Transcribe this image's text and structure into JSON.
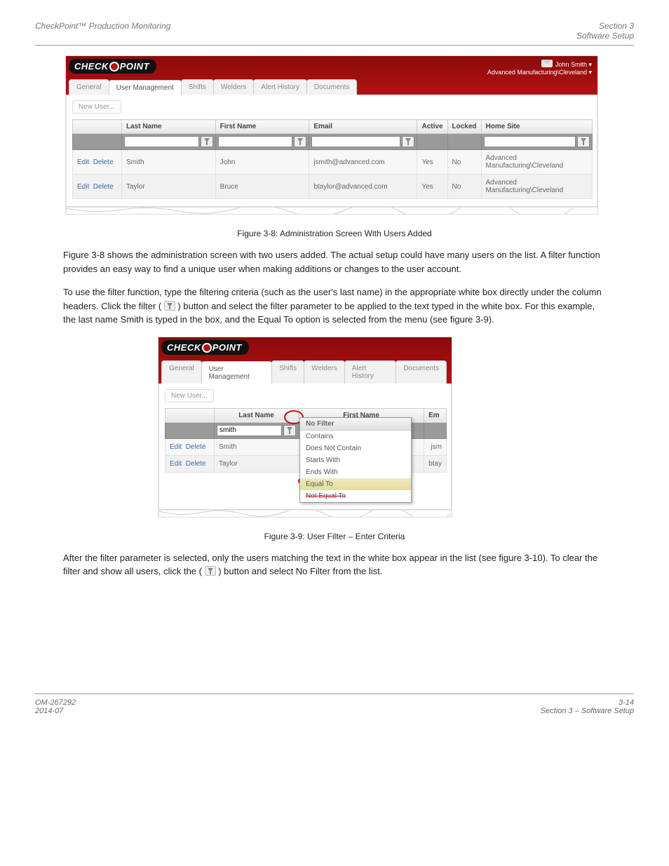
{
  "pageHeader": {
    "left": "CheckPoint™ Production Monitoring",
    "rightLine1": "Section 3",
    "rightLine2": "Software Setup"
  },
  "pageFooter": {
    "leftLine1": "OM-267292",
    "leftLine2": "2014-07",
    "rightLine1": "3-14",
    "rightLine2": "Section 3 – Software Setup"
  },
  "logo": {
    "chk": "CHECK",
    "pnt": "POINT"
  },
  "account": {
    "user": "John Smith",
    "site": "Advanced Manufacturing\\Cleveland"
  },
  "tabs": [
    "General",
    "User Management",
    "Shifts",
    "Welders",
    "Alert History",
    "Documents"
  ],
  "newUser": "New User...",
  "cols": {
    "last": "Last Name",
    "first": "First Name",
    "email": "Email",
    "active": "Active",
    "locked": "Locked",
    "home": "Home Site",
    "em": "Em"
  },
  "actions": {
    "edit": "Edit",
    "del": "Delete"
  },
  "rows": [
    {
      "last": "Smith",
      "first": "John",
      "email": "jsmith@advanced.com",
      "active": "Yes",
      "locked": "No",
      "home": "Advanced Manufacturing\\Cleveland",
      "em": "jsm"
    },
    {
      "last": "Taylor",
      "first": "Bruce",
      "email": "btaylor@advanced.com",
      "active": "Yes",
      "locked": "No",
      "home": "Advanced Manufacturing\\Cleveland",
      "em": "btay"
    }
  ],
  "filterValue": "smith",
  "filterMenu": {
    "title": "No Filter",
    "opts": [
      "Contains",
      "Does Not Contain",
      "Starts With",
      "Ends With",
      "Equal To",
      "Not Equal To"
    ]
  },
  "para1": "Figure 3-8 shows the administration screen with two users added. The actual setup could have many users on the list. A filter function provides an easy way to find a unique user when making additions or changes to the user account.",
  "fig1cap": "Figure 3-8: Administration Screen With Users Added",
  "para2a": "To use the filter function, type the filtering criteria (such as the user's last name) in the appropriate white box directly under the column headers. Click the filter (",
  "para2b": ") button and select the filter parameter to be applied to the text typed in the white box. For this example, the last name Smith is typed in the box, and the Equal To option is selected from the menu (see figure 3-9).",
  "fig2cap": "Figure 3-9: User Filter – Enter Criteria",
  "para3a": "After the filter parameter is selected, only the users matching the text in the white box appear in the list (see figure 3-10). To clear the filter and show all users, click the (",
  "para3b": ") button and select No Filter from the list."
}
